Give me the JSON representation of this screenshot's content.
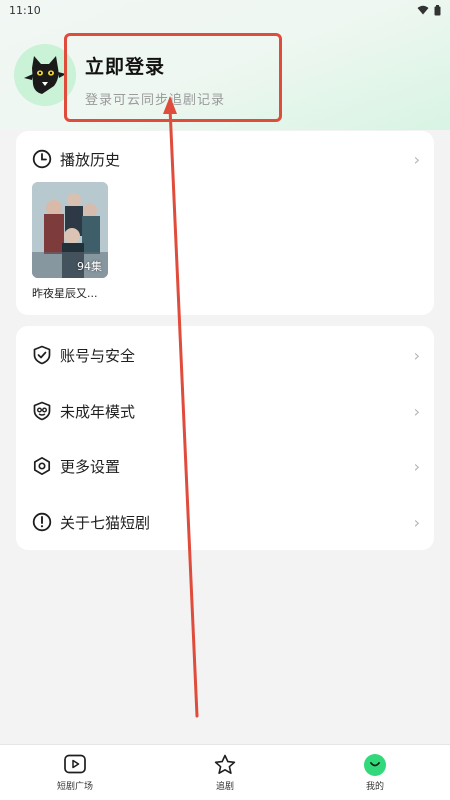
{
  "status_bar": {
    "time": "11:10",
    "icons": [
      "wifi-icon",
      "battery-icon"
    ]
  },
  "profile": {
    "login_title": "立即登录",
    "login_subtitle": "登录可云同步追剧记录",
    "avatar_icon": "cat-avatar-icon"
  },
  "history": {
    "title": "播放历史",
    "icon": "clock-icon",
    "items": [
      {
        "title": "昨夜星辰又...",
        "episodes": "94集"
      }
    ]
  },
  "menu": {
    "items": [
      {
        "label": "账号与安全",
        "icon": "shield-check-icon"
      },
      {
        "label": "未成年模式",
        "icon": "youth-mode-icon"
      },
      {
        "label": "更多设置",
        "icon": "settings-hexagon-icon"
      },
      {
        "label": "关于七猫短剧",
        "icon": "info-circle-icon"
      }
    ]
  },
  "bottom_nav": {
    "items": [
      {
        "label": "短剧广场",
        "icon": "play-square-icon"
      },
      {
        "label": "追剧",
        "icon": "star-icon"
      },
      {
        "label": "我的",
        "icon": "me-smile-icon",
        "active": true
      }
    ]
  },
  "colors": {
    "accent_green": "#32d97a",
    "highlight_red": "#e04c3c",
    "background": "#f3f3f3"
  }
}
